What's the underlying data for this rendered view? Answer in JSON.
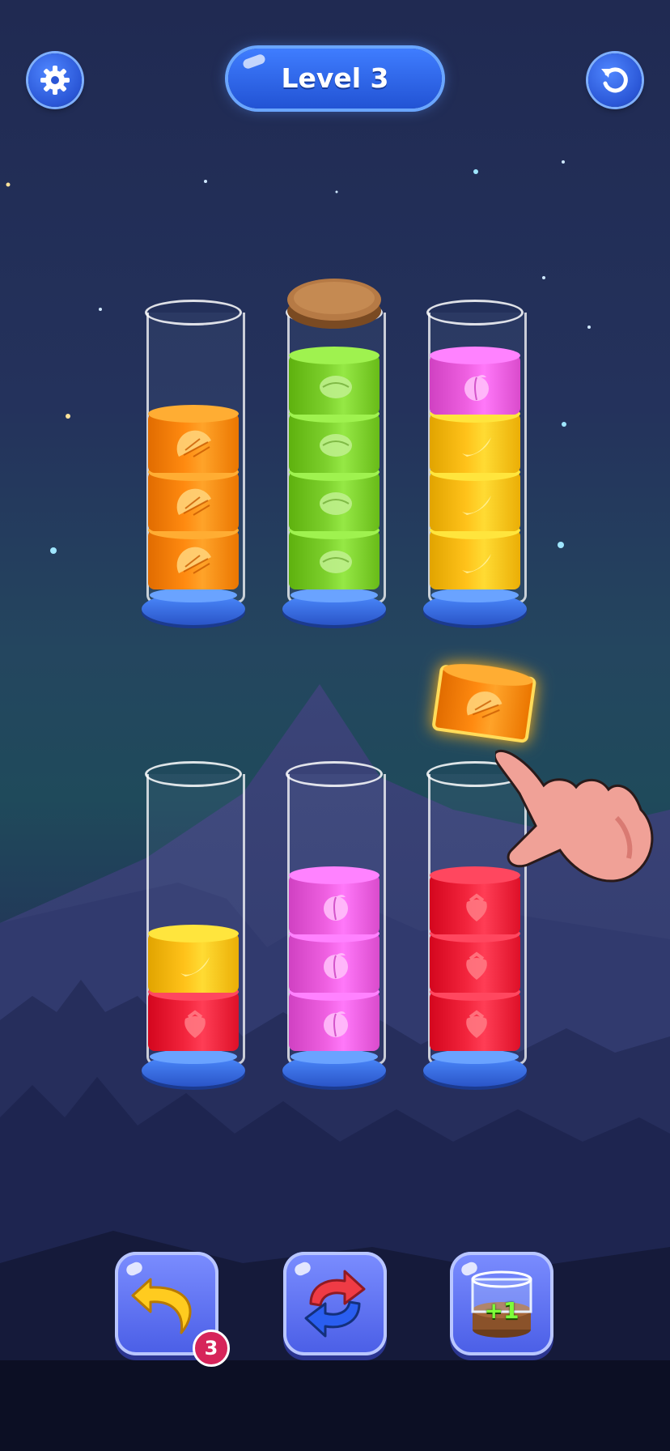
{
  "header": {
    "level_label": "Level 3",
    "settings_icon": "gear-icon",
    "restart_icon": "restart-icon"
  },
  "colors": {
    "orange": "#ff8a10",
    "green": "#7ccf2c",
    "pink": "#ee5fe0",
    "yellow": "#ffc21a",
    "red": "#f2243c",
    "cork": "#b67a45"
  },
  "tubes": [
    {
      "row": 1,
      "layers": [
        "orange",
        "orange",
        "orange"
      ],
      "sealed": false
    },
    {
      "row": 1,
      "layers": [
        "green",
        "green",
        "green",
        "green"
      ],
      "sealed": true
    },
    {
      "row": 1,
      "layers": [
        "yellow",
        "yellow",
        "yellow",
        "pink"
      ],
      "sealed": false
    },
    {
      "row": 2,
      "layers": [
        "red",
        "yellow"
      ],
      "sealed": false
    },
    {
      "row": 2,
      "layers": [
        "pink",
        "pink",
        "pink"
      ],
      "sealed": false
    },
    {
      "row": 2,
      "layers": [
        "red",
        "red",
        "red"
      ],
      "sealed": false
    }
  ],
  "fruit_icons": {
    "orange": "orange-slice-icon",
    "green": "lime-icon",
    "pink": "peach-icon",
    "yellow": "banana-icon",
    "red": "strawberry-icon"
  },
  "floating_block": {
    "color": "orange"
  },
  "tutorial": {
    "icon": "pointing-hand-icon"
  },
  "powerups": {
    "undo": {
      "icon": "undo-arrow-icon",
      "count": "3"
    },
    "shuffle": {
      "icon": "shuffle-icon"
    },
    "add_tube": {
      "icon": "add-tube-icon",
      "label": "+1"
    }
  }
}
